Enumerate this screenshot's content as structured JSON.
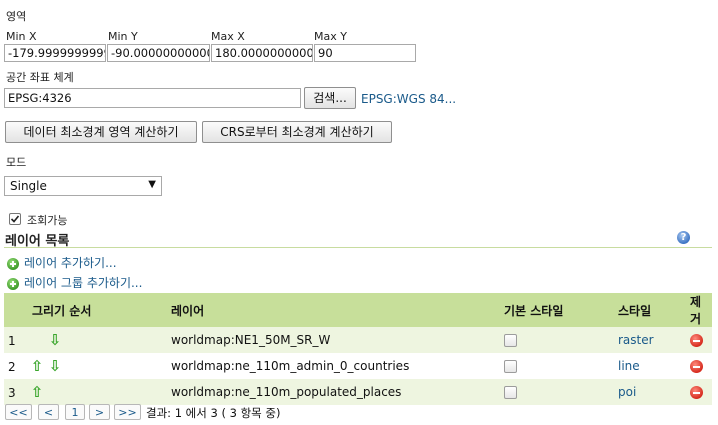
{
  "extent": {
    "section_label": "영역",
    "min_x": {
      "label": "Min X",
      "value": "-179.99999999999"
    },
    "min_y": {
      "label": "Min Y",
      "value": "-90.0000000000000"
    },
    "max_x": {
      "label": "Max X",
      "value": "180.000000000000"
    },
    "max_y": {
      "label": "Max Y",
      "value": "90"
    }
  },
  "crs": {
    "label": "공간 좌표 체계",
    "value": "EPSG:4326",
    "search_button": "검색...",
    "link": "EPSG:WGS 84..."
  },
  "actions": {
    "compute_from_data": "데이터 최소경계 영역 계산하기",
    "compute_from_crs": "CRS로부터 최소경계 계산하기"
  },
  "mode": {
    "label": "모드",
    "selected": "Single"
  },
  "queryable": {
    "label": "조회가능",
    "checked": true
  },
  "layers": {
    "title": "레이어 목록",
    "add_layer": "레이어 추가하기...",
    "add_group": "레이어 그룹 추가하기...",
    "columns": [
      "그리기 순서",
      "레이어",
      "기본 스타일",
      "스타일",
      "제거"
    ],
    "rows": [
      {
        "order": "1",
        "up": false,
        "down": true,
        "layer": "worldmap:NE1_50M_SR_W",
        "style": "raster"
      },
      {
        "order": "2",
        "up": true,
        "down": true,
        "layer": "worldmap:ne_110m_admin_0_countries",
        "style": "line"
      },
      {
        "order": "3",
        "up": true,
        "down": false,
        "layer": "worldmap:ne_110m_populated_places",
        "style": "poi"
      }
    ]
  },
  "pager": {
    "first": "<<",
    "prev": "<",
    "page": "1",
    "next": ">",
    "last": ">>",
    "summary": "결과: 1 에서 3 ( 3 항목 중)"
  },
  "colors": {
    "header_bg": "#c7df9a",
    "row_alt_bg": "#eef5e0",
    "link": "#1a5a8a",
    "arrow": "#3aa62c",
    "remove": "#d62b1e"
  }
}
